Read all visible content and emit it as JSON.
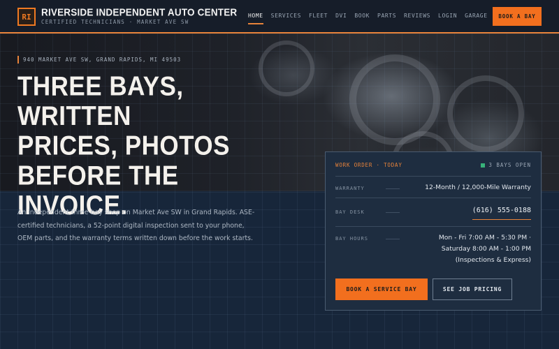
{
  "header": {
    "logo_initials": "RI",
    "brand_name": "RIVERSIDE INDEPENDENT AUTO CENTER",
    "brand_tagline": "CERTIFIED TECHNICIANS · MARKET AVE SW",
    "nav": [
      {
        "label": "HOME",
        "active": true
      },
      {
        "label": "SERVICES"
      },
      {
        "label": "FLEET"
      },
      {
        "label": "DVI"
      },
      {
        "label": "BOOK"
      },
      {
        "label": "PARTS"
      },
      {
        "label": "REVIEWS"
      },
      {
        "label": "LOGIN"
      },
      {
        "label": "GARAGE"
      }
    ],
    "cta_label": "BOOK A BAY"
  },
  "hero": {
    "address": "940 MARKET AVE SW, GRAND RAPIDS, MI 49503",
    "headline_lines": [
      "THREE BAYS, WRITTEN",
      "PRICES, PHOTOS",
      "BEFORE THE INVOICE."
    ],
    "intro": "An independent three-bay shop on Market Ave SW in Grand Rapids. ASE-certified technicians, a 52-point digital inspection sent to your phone, OEM parts, and the warranty terms written down before the work starts."
  },
  "work_order": {
    "title": "WORK ORDER · TODAY",
    "bays_status": "3 BAYS OPEN",
    "rows": [
      {
        "label": "WARRANTY",
        "value": "12-Month / 12,000-Mile Warranty"
      },
      {
        "label": "BAY DESK",
        "value": "(616) 555-0188"
      },
      {
        "label": "BAY HOURS",
        "value": "Mon - Fri 7:00 AM - 5:30 PM · Saturday 8:00 AM - 1:00 PM (Inspections & Express)"
      }
    ],
    "primary_button": "BOOK A SERVICE BAY",
    "secondary_button": "SEE JOB PRICING"
  },
  "colors": {
    "accent": "#f26f1e",
    "background": "#17263a",
    "status_open": "#38b27a"
  }
}
